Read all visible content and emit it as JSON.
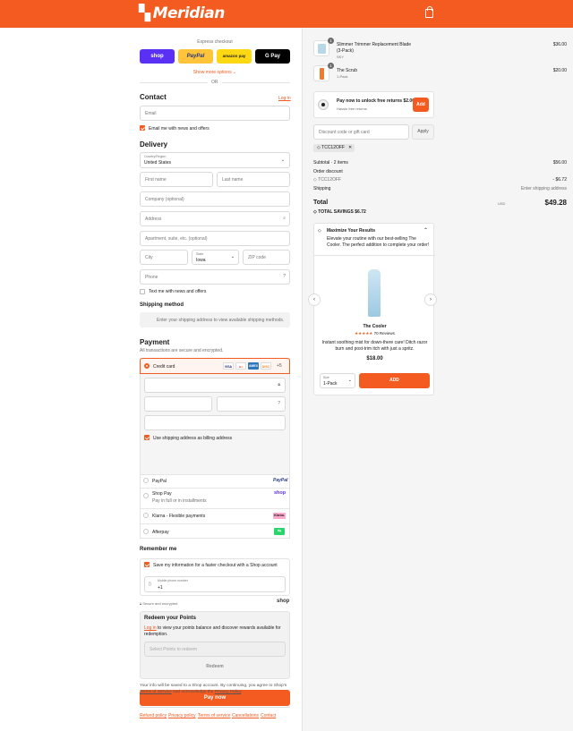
{
  "brand": {
    "name": "Meridian",
    "accent": "#f35b20"
  },
  "express": {
    "title": "Express checkout",
    "shop": "shop",
    "paypal": "PayPal",
    "amazon": "amazon pay",
    "gpay": "G Pay",
    "more": "Show more options ⌄",
    "or": "OR"
  },
  "contact": {
    "heading": "Contact",
    "login": "Log in",
    "email_placeholder": "Email",
    "news": "Email me with news and offers"
  },
  "delivery": {
    "heading": "Delivery",
    "country_label": "Country/Region",
    "country_value": "United States",
    "first": "First name",
    "last": "Last name",
    "company": "Company (optional)",
    "address": "Address",
    "apartment": "Apartment, suite, etc. (optional)",
    "city": "City",
    "state_label": "State",
    "state_value": "Iowa",
    "zip": "ZIP code",
    "phone": "Phone",
    "text_news": "Text me with news and offers"
  },
  "shipping": {
    "heading": "Shipping method",
    "note": "Enter your shipping address to view available shipping methods."
  },
  "payment": {
    "heading": "Payment",
    "sub": "All transactions are secure and encrypted.",
    "credit": "Credit card",
    "billing": "Use shipping address as billing address",
    "paypal": "PayPal",
    "shoppay": "Shop Pay",
    "shoppay_sub": "Pay in full or in installments",
    "klarna": "Klarna - Flexible payments",
    "afterpay": "Afterpay",
    "card_more": "+5",
    "shop_badge": "shop",
    "klarna_badge": "Klarna."
  },
  "remember": {
    "heading": "Remember me",
    "save": "Save my information for a faster checkout with a Shop account",
    "mobile_label": "Mobile phone number",
    "mobile_value": "+1",
    "secure": "Secure and encrypted",
    "shop": "shop"
  },
  "points": {
    "heading": "Redeem your Points",
    "login": "Log in",
    "text": " to view your points balance and discover rewards available for redemption.",
    "select": "Select Points to redeem",
    "redeem": "Redeem"
  },
  "pay": {
    "label": "Pay now",
    "note1": "Your info will be saved to a Shop account. By continuing, you agree to Shop's",
    "tos": "Terms of Service",
    "and": " and acknowledge the ",
    "privacy": "Privacy Policy",
    "dot": "."
  },
  "footer": [
    "Refund policy",
    "Privacy policy",
    "Terms of service",
    "Cancellations",
    "Contact"
  ],
  "cart": {
    "items": [
      {
        "name": "Slimmer Trimmer Replacement Blade (3-Pack)",
        "variant": "SKY",
        "price": "$36.00",
        "qty": "1"
      },
      {
        "name": "The Scrub",
        "variant": "1-Pack",
        "price": "$20.00",
        "qty": "1"
      }
    ],
    "promo_title": "Pay now to unlock free returns $2.00",
    "promo_sub": "Hassle free returns",
    "promo_add": "Add",
    "discount_placeholder": "Discount code or gift card",
    "apply": "Apply",
    "code": "TCC12OFF",
    "subtotal_label": "Subtotal · 2 items",
    "subtotal": "$56.00",
    "order_discount": "Order discount",
    "discount_code": "TCC12OFF",
    "discount": "- $6.72",
    "shipping_label": "Shipping",
    "shipping_value": "Enter shipping address",
    "total_label": "Total",
    "currency": "USD",
    "total": "$49.28",
    "savings_label": "TOTAL SAVINGS",
    "savings": "$6.72"
  },
  "upsell": {
    "heading": "Maximize Your Results",
    "text": "Elevate your routine with our best-selling The Cooler. The perfect addition to complete your order!",
    "product": "The Cooler",
    "stars": "★★★★★",
    "reviews": "70 Reviews",
    "desc": "Instant soothing mist for down-there care! Ditch razor burn and post-trim itch with just a spritz.",
    "price": "$18.00",
    "size_label": "Size",
    "size_value": "1-Pack",
    "add": "ADD"
  }
}
